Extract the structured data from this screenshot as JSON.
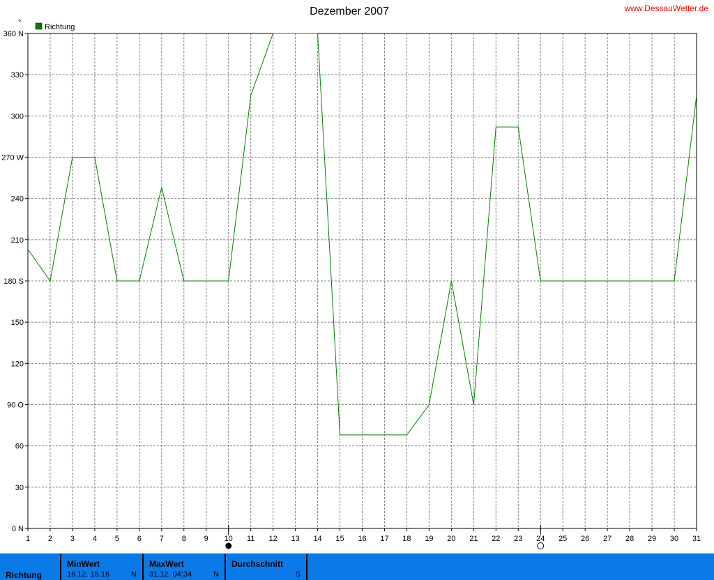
{
  "header": {
    "title": "Dezember 2007",
    "site": "www.DessauWetter.de",
    "unit_symbol": "°"
  },
  "colors": {
    "series": "#008000",
    "footer_bg": "#0a7ae8"
  },
  "chart_data": {
    "type": "line",
    "title": "Dezember 2007",
    "xlabel": "",
    "ylabel": "°",
    "xlim": [
      1,
      31
    ],
    "ylim": [
      0,
      360
    ],
    "grid": true,
    "legend_placement": "top-left",
    "x_ticks": [
      "1",
      "2",
      "3",
      "4",
      "5",
      "6",
      "7",
      "8",
      "9",
      "10",
      "11",
      "12",
      "13",
      "14",
      "15",
      "16",
      "17",
      "18",
      "19",
      "20",
      "21",
      "22",
      "23",
      "24",
      "25",
      "26",
      "27",
      "28",
      "29",
      "30",
      "31"
    ],
    "y_ticks": [
      {
        "value": 360,
        "label": "360 N"
      },
      {
        "value": 330,
        "label": "330"
      },
      {
        "value": 300,
        "label": "300"
      },
      {
        "value": 270,
        "label": "270 W"
      },
      {
        "value": 240,
        "label": "240"
      },
      {
        "value": 210,
        "label": "210"
      },
      {
        "value": 180,
        "label": "180 S"
      },
      {
        "value": 150,
        "label": "150"
      },
      {
        "value": 120,
        "label": "120"
      },
      {
        "value": 90,
        "label": "90   O"
      },
      {
        "value": 60,
        "label": "60"
      },
      {
        "value": 30,
        "label": "30"
      },
      {
        "value": 0,
        "label": "0   N"
      }
    ],
    "series": [
      {
        "name": "Richtung",
        "color": "#008000",
        "x": [
          1,
          2,
          3,
          4,
          5,
          6,
          7,
          8,
          9,
          10,
          11,
          12,
          13,
          14,
          15,
          16,
          17,
          18,
          19,
          20,
          21,
          22,
          23,
          24,
          25,
          26,
          27,
          28,
          29,
          30,
          31
        ],
        "values": [
          203,
          180,
          270,
          270,
          180,
          180,
          248,
          180,
          180,
          180,
          315,
          360,
          360,
          360,
          68,
          68,
          68,
          68,
          90,
          180,
          90,
          292,
          292,
          180,
          180,
          180,
          180,
          180,
          180,
          180,
          315
        ]
      }
    ],
    "moon_phases": [
      {
        "day": 10,
        "phase": "new-moon"
      },
      {
        "day": 24,
        "phase": "full-moon"
      }
    ]
  },
  "footer": {
    "series_label": "Richtung",
    "min": {
      "label": "MinWert",
      "value": "16.12.  15:16",
      "dir": "N"
    },
    "max": {
      "label": "MaxWert",
      "value": "31.12.  04:34",
      "dir": "N"
    },
    "avg": {
      "label": "Durchschnitt",
      "value": "",
      "dir": "S"
    }
  }
}
